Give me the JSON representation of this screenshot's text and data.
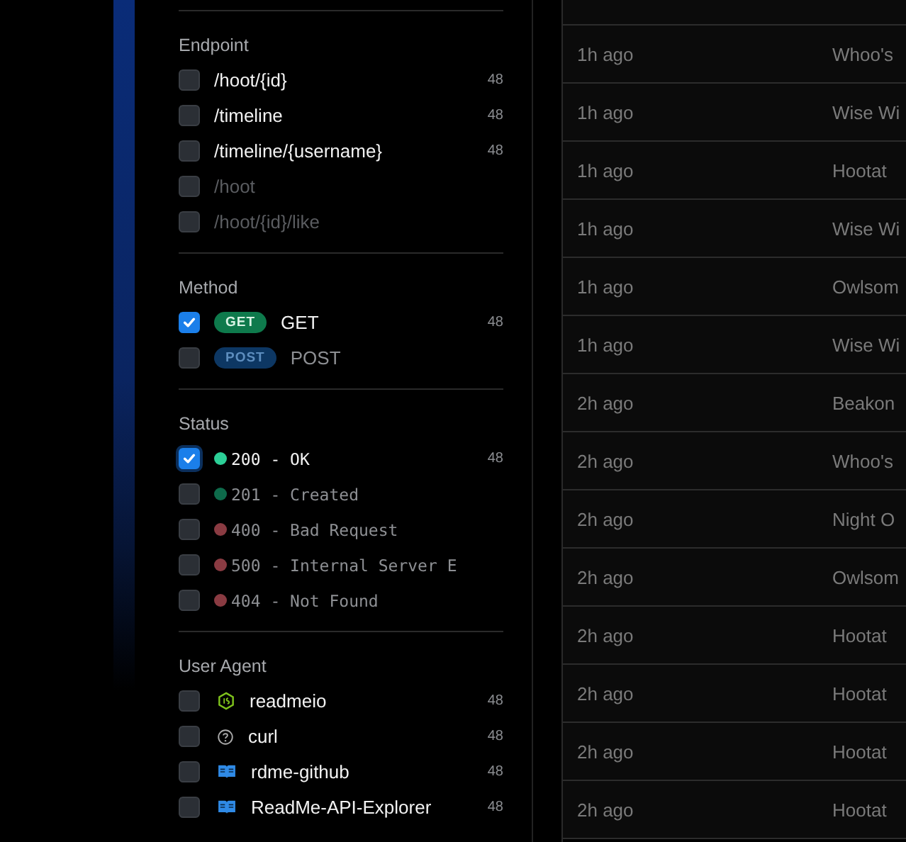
{
  "filters": [
    {
      "title": "Endpoint",
      "kind": "plain",
      "items": [
        {
          "label": "/hoot/{id}",
          "count": "48",
          "checked": false,
          "disabled": false
        },
        {
          "label": "/timeline",
          "count": "48",
          "checked": false,
          "disabled": false
        },
        {
          "label": "/timeline/{username}",
          "count": "48",
          "checked": false,
          "disabled": false
        },
        {
          "label": "/hoot",
          "checked": false,
          "disabled": true
        },
        {
          "label": "/hoot/{id}/like",
          "checked": false,
          "disabled": true
        }
      ]
    },
    {
      "title": "Method",
      "kind": "method",
      "items": [
        {
          "badge": "GET",
          "label": "GET",
          "count": "48",
          "checked": true,
          "disabled": false,
          "color": "#0e7a4c"
        },
        {
          "badge": "POST",
          "label": "POST",
          "checked": false,
          "disabled": true,
          "color": "#0d3763"
        }
      ]
    },
    {
      "title": "Status",
      "kind": "status",
      "items": [
        {
          "label": "200 - OK",
          "count": "48",
          "checked": true,
          "focused": true,
          "disabled": false,
          "color": "#2ccf97"
        },
        {
          "label": "201 - Created",
          "checked": false,
          "disabled": true,
          "color": "#0e6b4b"
        },
        {
          "label": "400 - Bad Request",
          "checked": false,
          "disabled": true,
          "color": "#8a3b42"
        },
        {
          "label": "500 - Internal Server E",
          "checked": false,
          "disabled": true,
          "color": "#8a3b42"
        },
        {
          "label": "404 - Not Found",
          "checked": false,
          "disabled": true,
          "color": "#8a3b42"
        }
      ]
    },
    {
      "title": "User Agent",
      "kind": "agent",
      "items": [
        {
          "label": "readmeio",
          "count": "48",
          "checked": false,
          "disabled": false
        },
        {
          "label": "curl",
          "count": "48",
          "checked": false,
          "disabled": false
        },
        {
          "label": "rdme-github",
          "count": "48",
          "checked": false,
          "disabled": false
        },
        {
          "label": "ReadMe-API-Explorer",
          "count": "48",
          "checked": false,
          "disabled": false
        }
      ]
    }
  ],
  "table": {
    "rows": [
      {
        "time": "1h ago",
        "name": "Whoo's"
      },
      {
        "time": "1h ago",
        "name": "Wise Wi"
      },
      {
        "time": "1h ago",
        "name": "Hootat"
      },
      {
        "time": "1h ago",
        "name": "Wise Wi"
      },
      {
        "time": "1h ago",
        "name": "Owlsom"
      },
      {
        "time": "1h ago",
        "name": "Wise Wi"
      },
      {
        "time": "2h ago",
        "name": "Beakon"
      },
      {
        "time": "2h ago",
        "name": "Whoo's"
      },
      {
        "time": "2h ago",
        "name": "Night O"
      },
      {
        "time": "2h ago",
        "name": "Owlsom"
      },
      {
        "time": "2h ago",
        "name": "Hootat"
      },
      {
        "time": "2h ago",
        "name": "Hootat"
      },
      {
        "time": "2h ago",
        "name": "Hootat"
      },
      {
        "time": "2h ago",
        "name": "Hootat"
      }
    ]
  }
}
